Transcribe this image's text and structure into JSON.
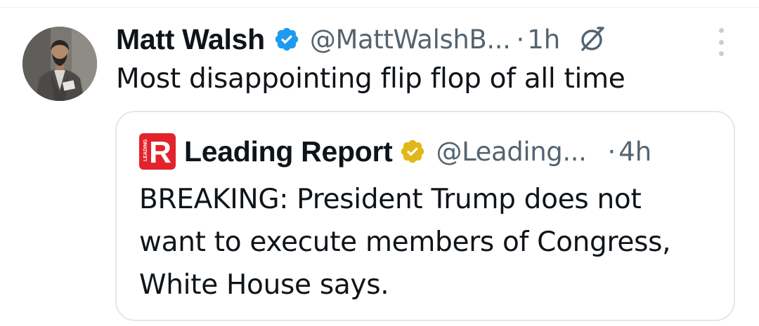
{
  "tweet": {
    "author": {
      "display_name": "Matt Walsh",
      "handle": "@MattWalshB...",
      "verified_icon": "blue-verified-badge",
      "avatar_icon": "profile-photo"
    },
    "separator": "·",
    "time": "1h",
    "grok_icon": "grok-icon",
    "more_icon": "more-vertical-icon",
    "text": "Most disappointing flip flop of all time",
    "colors": {
      "primary_text": "#0f1419",
      "secondary_text": "#536471",
      "verified_blue": "#1d9bf0",
      "card_border": "#e1e8ed"
    }
  },
  "quote": {
    "author": {
      "display_name": "Leading Report",
      "handle": "@Leading...",
      "verified_icon": "gold-verified-badge",
      "avatar_logo_text": "R",
      "avatar_logo_small_text": "LEADING"
    },
    "separator": "·",
    "time": "4h",
    "text_lines": [
      "BREAKING: President Trump does not",
      "want to execute members of Congress,",
      "White House says."
    ],
    "colors": {
      "logo_red": "#e3232c",
      "gold_badge": "#e2b719"
    }
  }
}
